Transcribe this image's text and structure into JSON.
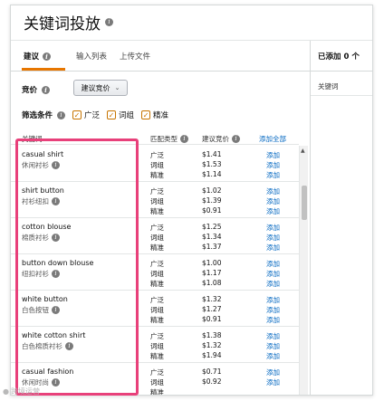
{
  "title": "关键词投放",
  "tabs": [
    {
      "label": "建议",
      "active": true
    },
    {
      "label": "输入列表",
      "active": false
    },
    {
      "label": "上传文件",
      "active": false
    }
  ],
  "bid": {
    "label": "竞价",
    "select_value": "建议竞价"
  },
  "filter": {
    "label": "筛选条件",
    "options": [
      {
        "label": "广泛",
        "checked": true
      },
      {
        "label": "词组",
        "checked": true
      },
      {
        "label": "精准",
        "checked": true
      }
    ]
  },
  "table": {
    "headers": {
      "keyword": "关键词",
      "match_type": "匹配类型",
      "suggested_bid": "建议竞价",
      "add_all": "添加全部"
    },
    "match_types": [
      "广泛",
      "词组",
      "精准"
    ],
    "add_label": "添加",
    "rows": [
      {
        "keyword": "casual shirt",
        "translation": "休闲衬衫",
        "bids": [
          "$1.41",
          "$1.53",
          "$1.14"
        ]
      },
      {
        "keyword": "shirt button",
        "translation": "衬衫纽扣",
        "bids": [
          "$1.02",
          "$1.39",
          "$0.91"
        ]
      },
      {
        "keyword": "cotton blouse",
        "translation": "棉质衬衫",
        "bids": [
          "$1.25",
          "$1.34",
          "$1.37"
        ]
      },
      {
        "keyword": "button down blouse",
        "translation": "纽扣衬衫",
        "bids": [
          "$1.00",
          "$1.17",
          "$1.08"
        ]
      },
      {
        "keyword": "white button",
        "translation": "白色按钮",
        "bids": [
          "$1.32",
          "$1.27",
          "$0.91"
        ]
      },
      {
        "keyword": "white cotton shirt",
        "translation": "白色棉质衬衫",
        "bids": [
          "$1.38",
          "$1.32",
          "$1.94"
        ]
      },
      {
        "keyword": "casual fashion",
        "translation": "休闲时尚",
        "bids": [
          "$0.71",
          "$0.92",
          ""
        ]
      }
    ]
  },
  "added_panel": {
    "title": "已添加 0 个",
    "column": "关键词"
  },
  "watermark": "跨境运营",
  "colors": {
    "accent": "#e77600",
    "link": "#0066c0",
    "highlight": "#e8407a"
  }
}
